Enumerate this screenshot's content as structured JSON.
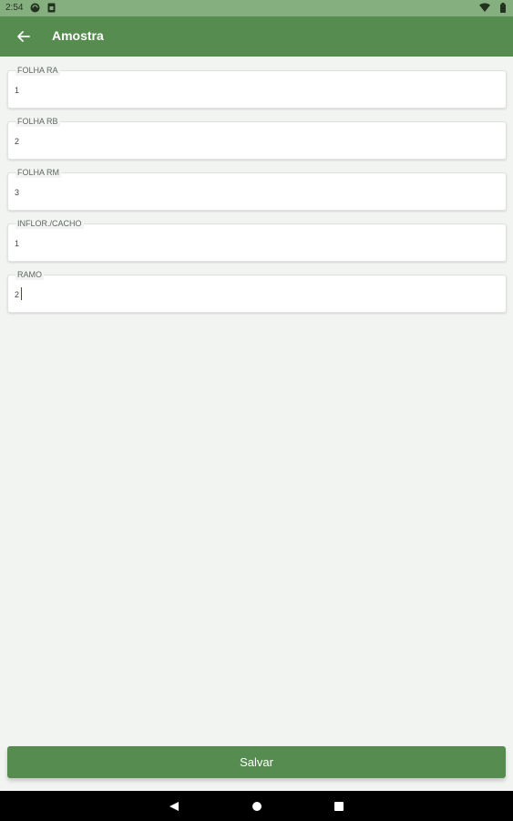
{
  "status_bar": {
    "time": "2:54",
    "left_icons": [
      "sync-icon",
      "sim-card-icon"
    ],
    "right_icons": [
      "wifi-icon",
      "battery-icon"
    ]
  },
  "app_bar": {
    "title": "Amostra",
    "back_icon": "arrow-back-icon",
    "color": "#568c4f"
  },
  "form": {
    "fields": [
      {
        "label": "FOLHA RA",
        "value": "1"
      },
      {
        "label": "FOLHA RB",
        "value": "2"
      },
      {
        "label": "FOLHA RM",
        "value": "3"
      },
      {
        "label": "INFLOR./CACHO",
        "value": "1"
      },
      {
        "label": "RAMO",
        "value": "2",
        "focused": true
      }
    ]
  },
  "save_button": {
    "label": "Salvar",
    "color": "#568c4f"
  },
  "nav_bar": {
    "icons": [
      "back-triangle-icon",
      "home-circle-icon",
      "recents-square-icon"
    ]
  }
}
